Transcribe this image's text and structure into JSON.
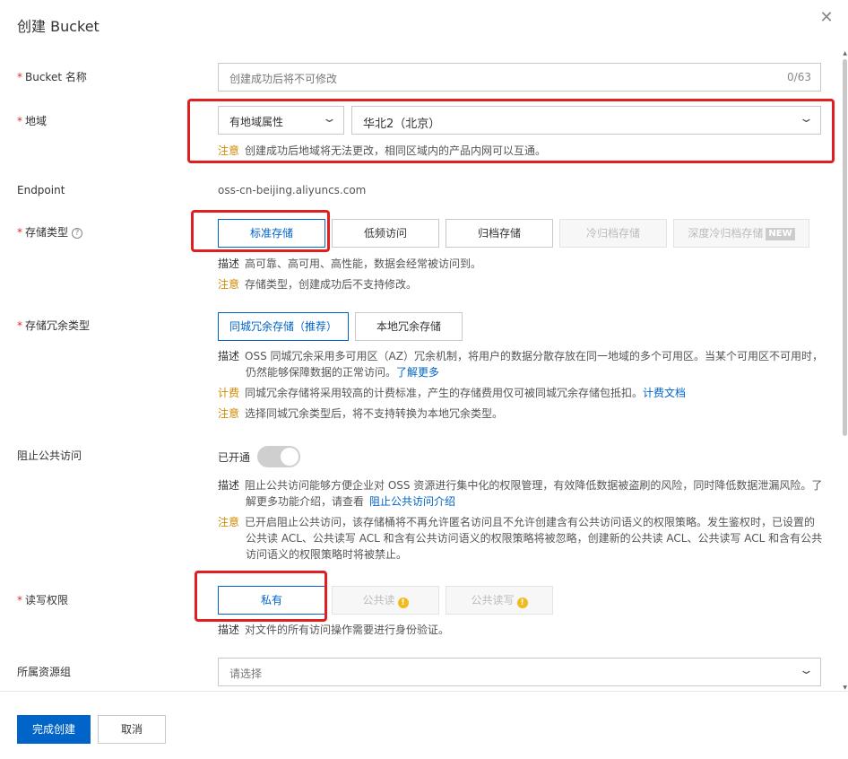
{
  "dialog": {
    "title": "创建 Bucket",
    "close_icon": "close-icon"
  },
  "fields": {
    "bucket_name": {
      "label": "Bucket 名称",
      "required": "*",
      "placeholder": "创建成功后将不可修改",
      "counter": "0/63"
    },
    "region": {
      "label": "地域",
      "required": "*",
      "attr_select": "有地域属性",
      "region_select": "华北2（北京）",
      "note_tag": "注意",
      "note": "创建成功后地域将无法更改，相同区域内的产品内网可以互通。"
    },
    "endpoint": {
      "label": "Endpoint",
      "value": "oss-cn-beijing.aliyuncs.com"
    },
    "storage_class": {
      "label": "存储类型",
      "required": "*",
      "options": [
        "标准存储",
        "低频访问",
        "归档存储",
        "冷归档存储",
        "深度冷归档存储"
      ],
      "new_tag": "NEW",
      "desc_tag": "描述",
      "desc": "高可靠、高可用、高性能，数据会经常被访问到。",
      "note_tag": "注意",
      "note": "存储类型，创建成功后不支持修改。"
    },
    "redundancy": {
      "label": "存储冗余类型",
      "required": "*",
      "options": [
        "同城冗余存储（推荐）",
        "本地冗余存储"
      ],
      "desc_tag": "描述",
      "desc_line1": "OSS 同城冗余采用多可用区（AZ）冗余机制，将用户的数据分散存放在同一地域的多个可用区。当某个可用区不可用时，",
      "desc_line2": "仍然能够保障数据的正常访问。",
      "desc_link": "了解更多",
      "billing_tag": "计费",
      "billing": "同城冗余存储将采用较高的计费标准，产生的存储费用仅可被同城冗余存储包抵扣。",
      "billing_link": "计费文档",
      "note_tag": "注意",
      "note": "选择同城冗余类型后，将不支持转换为本地冗余类型。"
    },
    "block_public": {
      "label": "阻止公共访问",
      "status": "已开通",
      "desc_tag": "描述",
      "desc_line1": "阻止公共访问能够方便企业对 OSS 资源进行集中化的权限管理，有效降低数据被盗刷的风险，同时降低数据泄漏风险。了",
      "desc_line2": "解更多功能介绍，请查看",
      "desc_link": "阻止公共访问介绍",
      "note_tag": "注意",
      "note_line1": "已开启阻止公共访问，该存储桶将不再允许匿名访问且不允许创建含有公共访问语义的权限策略。发生鉴权时，已设置的",
      "note_line2": "公共读 ACL、公共读写 ACL 和含有公共访问语义的权限策略将被忽略，创建新的公共读 ACL、公共读写 ACL 和含有公共",
      "note_line3": "访问语义的权限策略时将被禁止。"
    },
    "acl": {
      "label": "读写权限",
      "required": "*",
      "options": [
        "私有",
        "公共读",
        "公共读写"
      ],
      "desc_tag": "描述",
      "desc": "对文件的所有访问操作需要进行身份验证。"
    },
    "resource_group": {
      "label": "所属资源组",
      "placeholder": "请选择"
    }
  },
  "footer": {
    "submit_label": "完成创建",
    "cancel_label": "取消"
  },
  "colors": {
    "primary": "#0064c8",
    "required": "#d93026",
    "highlight_box": "#e02020",
    "warning": "#d08a00"
  }
}
